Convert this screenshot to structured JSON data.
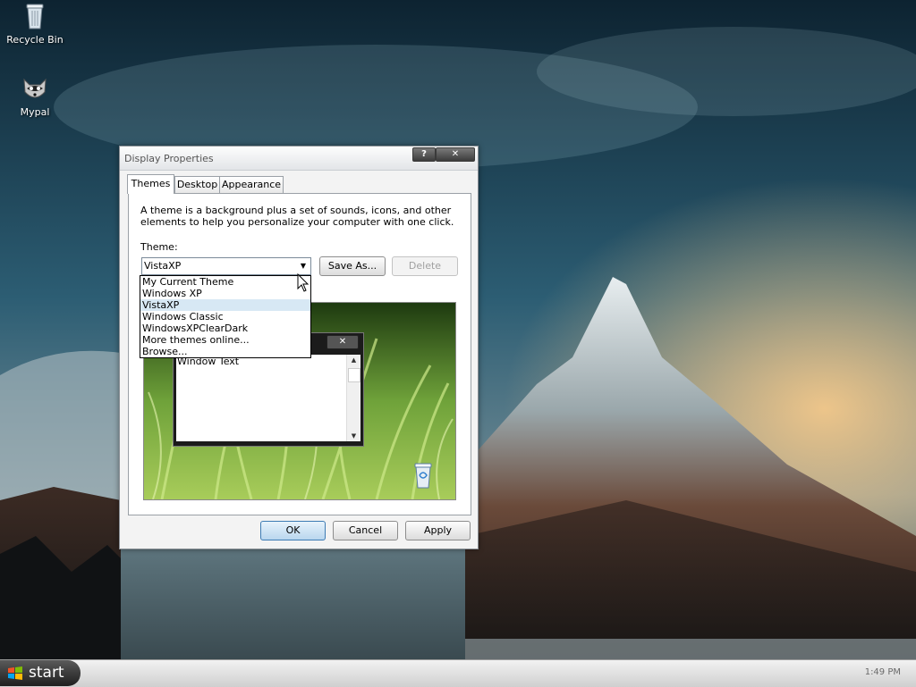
{
  "desktop": {
    "icons": [
      {
        "label": "Recycle Bin",
        "icon": "recycle-bin-icon"
      },
      {
        "label": "Mypal",
        "icon": "raccoon-icon"
      }
    ]
  },
  "dialog": {
    "title": "Display Properties",
    "help_label": "?",
    "close_label": "✕",
    "tabs": [
      {
        "label": "Themes",
        "selected": true
      },
      {
        "label": "Desktop",
        "selected": false
      },
      {
        "label": "Appearance",
        "selected": false
      }
    ],
    "description": "A theme is a background plus a set of sounds, icons, and other elements to help you personalize your computer with one click.",
    "theme_label": "Theme:",
    "theme_value": "VistaXP",
    "save_as_label": "Save As...",
    "delete_label": "Delete",
    "dropdown_items": [
      "My Current Theme",
      "Windows XP",
      "VistaXP",
      "Windows Classic",
      "WindowsXPClearDark",
      "More themes online...",
      "Browse..."
    ],
    "dropdown_selected": "VistaXP",
    "preview": {
      "window_text": "Window Text",
      "close_label": "✕"
    },
    "ok_label": "OK",
    "cancel_label": "Cancel",
    "apply_label": "Apply"
  },
  "taskbar": {
    "start_label": "start",
    "clock": "1:49 PM"
  },
  "colors": {
    "selection": "#d7e8f4",
    "ok_border": "#3e7cb4",
    "disabled_text": "#a0a0a0"
  }
}
